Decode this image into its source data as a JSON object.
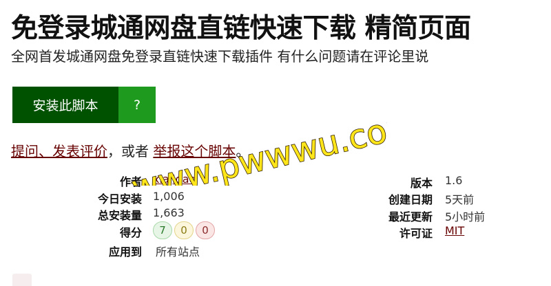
{
  "header": {
    "title": "免登录城通网盘直链快速下载 精简页面",
    "subtitle": "全网首发城通网盘免登录直链快速下载插件 有什么问题请在评论里说"
  },
  "actions": {
    "install_label": "安装此脚本",
    "help_label": "?"
  },
  "feedback": {
    "ask_link": "提问、发表评价",
    "middle_text": "，或者 ",
    "report_link": "举报这个脚本",
    "end_text": "。"
  },
  "info": {
    "author_label": "作者",
    "author_value": "xiajiqaq",
    "installs_today_label": "今日安装",
    "installs_today_value": "1,006",
    "total_installs_label": "总安装量",
    "total_installs_value": "1,663",
    "score_label": "得分",
    "score_good": "7",
    "score_ok": "0",
    "score_bad": "0",
    "applies_label": "应用到",
    "applies_value": "所有站点",
    "version_label": "版本",
    "version_value": "1.6",
    "created_label": "创建日期",
    "created_value": "5天前",
    "updated_label": "最近更新",
    "updated_value": "5小时前",
    "license_label": "许可证",
    "license_value": "MIT"
  },
  "watermark": {
    "text": "www.pwwwu.com"
  },
  "colors": {
    "install_button": "#005200",
    "help_button": "#1e9a1e",
    "link": "#670000",
    "watermark": "#ffe51a"
  }
}
